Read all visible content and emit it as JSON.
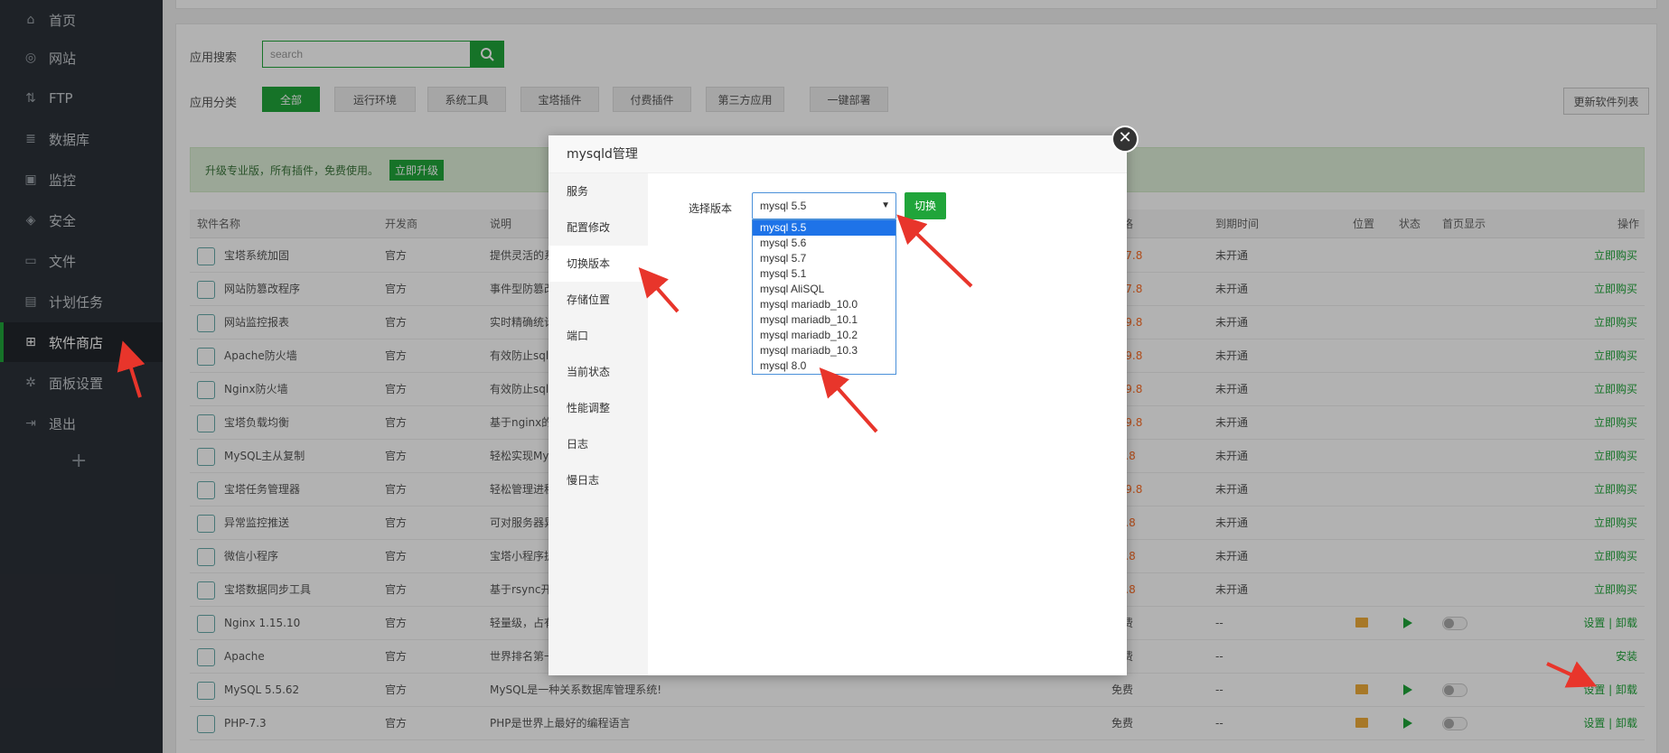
{
  "sidebar": {
    "items": [
      {
        "label": "首页",
        "icon": "home-icon",
        "glyph": "⌂"
      },
      {
        "label": "网站",
        "icon": "globe-icon",
        "glyph": "◎"
      },
      {
        "label": "FTP",
        "icon": "ftp-icon",
        "glyph": "⇅"
      },
      {
        "label": "数据库",
        "icon": "database-icon",
        "glyph": "≣"
      },
      {
        "label": "监控",
        "icon": "monitor-icon",
        "glyph": "▣"
      },
      {
        "label": "安全",
        "icon": "shield-icon",
        "glyph": "◈"
      },
      {
        "label": "文件",
        "icon": "folder-icon",
        "glyph": "▭"
      },
      {
        "label": "计划任务",
        "icon": "calendar-icon",
        "glyph": "▤"
      },
      {
        "label": "软件商店",
        "icon": "grid-icon",
        "glyph": "⊞"
      },
      {
        "label": "面板设置",
        "icon": "gear-icon",
        "glyph": "✲"
      },
      {
        "label": "退出",
        "icon": "logout-icon",
        "glyph": "⇥"
      }
    ],
    "add_glyph": "+"
  },
  "search": {
    "label": "应用搜索",
    "placeholder": "search"
  },
  "categories": {
    "label": "应用分类",
    "items": [
      "全部",
      "运行环境",
      "系统工具",
      "宝塔插件",
      "付费插件",
      "第三方应用",
      "一键部署"
    ]
  },
  "update_button": "更新软件列表",
  "notice": {
    "text": "升级专业版，所有插件，免费使用。",
    "button": "立即升级"
  },
  "table": {
    "headers": [
      "软件名称",
      "开发商",
      "说明",
      "价格",
      "到期时间",
      "位置",
      "状态",
      "首页显示",
      "操作"
    ],
    "rows": [
      {
        "name": "宝塔系统加固",
        "dev": "官方",
        "desc": "提供灵活的系统加固",
        "price": "¥37.8",
        "expire": "未开通",
        "op": "立即购买"
      },
      {
        "name": "网站防篡改程序",
        "dev": "官方",
        "desc": "事件型防篡改程序",
        "price": "¥37.8",
        "expire": "未开通",
        "op": "立即购买"
      },
      {
        "name": "网站监控报表",
        "dev": "官方",
        "desc": "实时精确统计网站",
        "price": "¥59.8",
        "expire": "未开通",
        "op": "立即购买"
      },
      {
        "name": "Apache防火墙",
        "dev": "官方",
        "desc": "有效防止sql注入",
        "price": "¥59.8",
        "expire": "未开通",
        "op": "立即购买"
      },
      {
        "name": "Nginx防火墙",
        "dev": "官方",
        "desc": "有效防止sql注入",
        "price": "¥59.8",
        "expire": "未开通",
        "op": "立即购买"
      },
      {
        "name": "宝塔负载均衡",
        "dev": "官方",
        "desc": "基于nginx的负载均衡",
        "price": "¥59.8",
        "expire": "未开通",
        "op": "立即购买"
      },
      {
        "name": "MySQL主从复制",
        "dev": "官方",
        "desc": "轻松实现MySQL主从",
        "price": "¥9.8",
        "expire": "未开通",
        "op": "立即购买"
      },
      {
        "name": "宝塔任务管理器",
        "dev": "官方",
        "desc": "轻松管理进程",
        "price": "¥19.8",
        "expire": "未开通",
        "op": "立即购买"
      },
      {
        "name": "异常监控推送",
        "dev": "官方",
        "desc": "可对服务器异常",
        "price": "¥9.8",
        "expire": "未开通",
        "op": "立即购买"
      },
      {
        "name": "微信小程序",
        "dev": "官方",
        "desc": "宝塔小程序提供",
        "price": "¥4.8",
        "expire": "未开通",
        "op": "立即购买"
      },
      {
        "name": "宝塔数据同步工具",
        "dev": "官方",
        "desc": "基于rsync开发",
        "price": "¥4.8",
        "expire": "未开通",
        "op": "立即购买"
      },
      {
        "name": "Nginx 1.15.10",
        "dev": "官方",
        "desc": "轻量级，占有内存少",
        "price": "免费",
        "expire": "--",
        "op": "设置 | 卸载"
      },
      {
        "name": "Apache",
        "dev": "官方",
        "desc": "世界排名第一",
        "price": "免费",
        "expire": "--",
        "op": "安装"
      },
      {
        "name": "MySQL 5.5.62",
        "dev": "官方",
        "desc": "MySQL是一种关系数据库管理系统!",
        "price": "免费",
        "expire": "--",
        "op": "设置 | 卸载"
      },
      {
        "name": "PHP-7.3",
        "dev": "官方",
        "desc": "PHP是世界上最好的编程语言",
        "price": "免费",
        "expire": "--",
        "op": "设置 | 卸载"
      }
    ]
  },
  "modal": {
    "title": "mysqld管理",
    "close_glyph": "✕",
    "tabs": [
      "服务",
      "配置修改",
      "切换版本",
      "存储位置",
      "端口",
      "当前状态",
      "性能调整",
      "日志",
      "慢日志"
    ],
    "version_label": "选择版本",
    "selected_version": "mysql 5.5",
    "caret": "▼",
    "switch_button": "切换",
    "options": [
      "mysql 5.5",
      "mysql 5.6",
      "mysql 5.7",
      "mysql 5.1",
      "mysql AliSQL",
      "mysql mariadb_10.0",
      "mysql mariadb_10.1",
      "mysql mariadb_10.2",
      "mysql mariadb_10.3",
      "mysql 8.0"
    ]
  },
  "colors": {
    "accent": "#20a53a",
    "sidebar": "#2c3138",
    "arrow": "#e8352b",
    "select_highlight": "#1e73e8"
  }
}
